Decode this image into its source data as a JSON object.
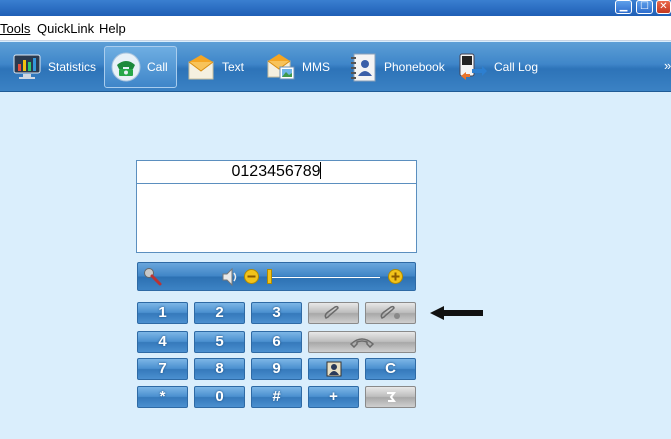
{
  "window": {
    "controls": [
      {
        "name": "minimize",
        "glyph": "▁"
      },
      {
        "name": "maximize",
        "glyph": "☐"
      },
      {
        "name": "close",
        "glyph": "✕"
      }
    ]
  },
  "menu": {
    "items": [
      "Tools",
      "QuickLink",
      "Help"
    ]
  },
  "toolbar": {
    "items": [
      {
        "label": "Statistics",
        "icon": "statistics-monitor-icon"
      },
      {
        "label": "Call",
        "icon": "phone-icon",
        "active": true
      },
      {
        "label": "Text",
        "icon": "envelope-icon"
      },
      {
        "label": "MMS",
        "icon": "mms-envelope-icon"
      },
      {
        "label": "Phonebook",
        "icon": "phonebook-icon"
      },
      {
        "label": "Call Log",
        "icon": "call-log-icon"
      }
    ],
    "overflow": "»"
  },
  "dialer": {
    "number": "0123456789",
    "volume_level": 0.0
  },
  "keypad": {
    "keys": [
      "1",
      "2",
      "3",
      "4",
      "5",
      "6",
      "7",
      "8",
      "9",
      "*",
      "0",
      "#",
      "+",
      "C"
    ]
  },
  "colors": {
    "background": "#daeefc",
    "toolbar": "#3f86c9",
    "key_blue": "#4a8fcf",
    "key_gray": "#bdbdbd"
  }
}
